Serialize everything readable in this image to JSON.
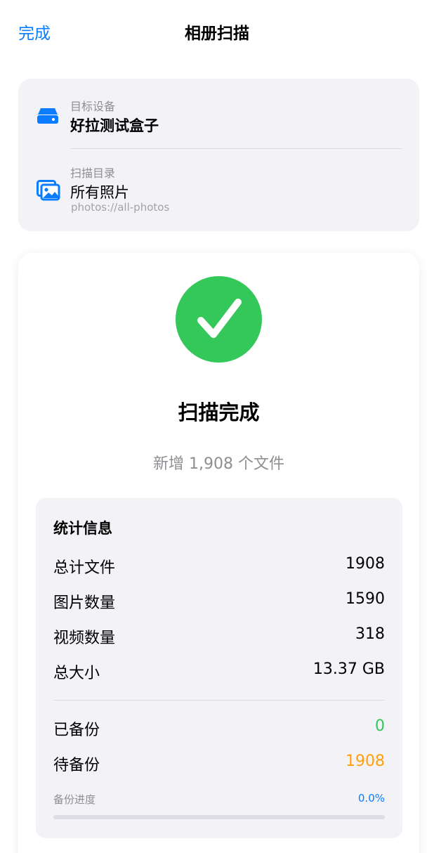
{
  "nav": {
    "done_label": "完成",
    "title": "相册扫描"
  },
  "info": {
    "device_label": "目标设备",
    "device_value": "好拉测试盒子",
    "device_icon": "drive-icon",
    "directory_label": "扫描目录",
    "directory_value": "所有照片",
    "directory_path": "photos://all-photos",
    "directory_icon": "photos-icon"
  },
  "result": {
    "status_icon": "checkmark-circle-icon",
    "title": "扫描完成",
    "subtitle": "新增 1,908 个文件"
  },
  "stats": {
    "title": "统计信息",
    "rows": [
      {
        "label": "总计文件",
        "value": "1908"
      },
      {
        "label": "图片数量",
        "value": "1590"
      },
      {
        "label": "视频数量",
        "value": "318"
      },
      {
        "label": "总大小",
        "value": "13.37 GB"
      }
    ],
    "backup_rows": [
      {
        "label": "已备份",
        "value": "0"
      },
      {
        "label": "待备份",
        "value": "1908"
      }
    ],
    "progress_label": "备份进度",
    "progress_text": "0.0%",
    "progress_fraction": 0.0
  },
  "colors": {
    "accent": "#0a7cff",
    "success": "#34c759",
    "pending": "#ff9f0a",
    "card_bg": "#f2f2f7",
    "secondary_text": "#8e8e93"
  }
}
